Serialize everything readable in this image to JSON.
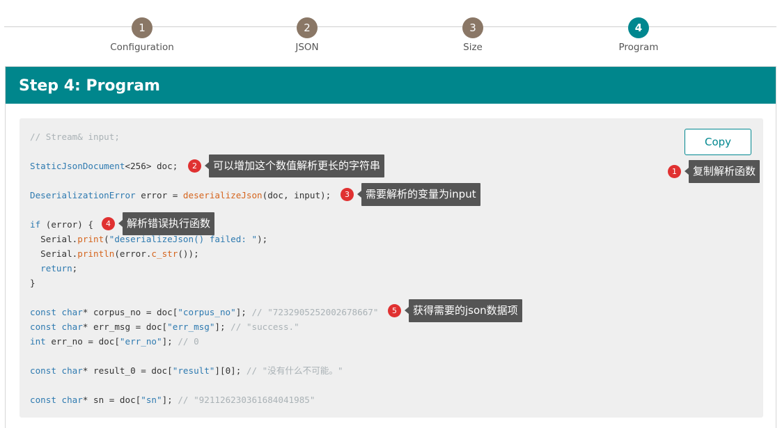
{
  "stepper": {
    "steps": [
      {
        "number": "1",
        "label": "Configuration"
      },
      {
        "number": "2",
        "label": "JSON"
      },
      {
        "number": "3",
        "label": "Size"
      },
      {
        "number": "4",
        "label": "Program"
      }
    ],
    "active_step": 4
  },
  "panel": {
    "title": "Step 4: Program",
    "copy_label": "Copy"
  },
  "code_lines": [
    [
      {
        "t": "// Stream& input;",
        "c": "comment"
      }
    ],
    [],
    [
      {
        "t": "StaticJsonDocument",
        "c": "type"
      },
      {
        "t": "<256> doc;",
        "c": "plain"
      }
    ],
    [],
    [
      {
        "t": "DeserializationError",
        "c": "type"
      },
      {
        "t": " error = ",
        "c": "plain"
      },
      {
        "t": "deserializeJson",
        "c": "fn"
      },
      {
        "t": "(doc, input);",
        "c": "plain"
      }
    ],
    [],
    [
      {
        "t": "if",
        "c": "kw"
      },
      {
        "t": " (error) {",
        "c": "plain"
      }
    ],
    [
      {
        "t": "  Serial.",
        "c": "plain"
      },
      {
        "t": "print",
        "c": "fn"
      },
      {
        "t": "(",
        "c": "plain"
      },
      {
        "t": "\"deserializeJson() failed: \"",
        "c": "str"
      },
      {
        "t": ");",
        "c": "plain"
      }
    ],
    [
      {
        "t": "  Serial.",
        "c": "plain"
      },
      {
        "t": "println",
        "c": "fn"
      },
      {
        "t": "(error.",
        "c": "plain"
      },
      {
        "t": "c_str",
        "c": "fn"
      },
      {
        "t": "());",
        "c": "plain"
      }
    ],
    [
      {
        "t": "  ",
        "c": "plain"
      },
      {
        "t": "return",
        "c": "kw"
      },
      {
        "t": ";",
        "c": "plain"
      }
    ],
    [
      {
        "t": "}",
        "c": "plain"
      }
    ],
    [],
    [
      {
        "t": "const char",
        "c": "kw"
      },
      {
        "t": "* corpus_no = doc[",
        "c": "plain"
      },
      {
        "t": "\"corpus_no\"",
        "c": "str"
      },
      {
        "t": "]; ",
        "c": "plain"
      },
      {
        "t": "// \"7232905252002678667\"",
        "c": "comment"
      }
    ],
    [
      {
        "t": "const char",
        "c": "kw"
      },
      {
        "t": "* err_msg = doc[",
        "c": "plain"
      },
      {
        "t": "\"err_msg\"",
        "c": "str"
      },
      {
        "t": "]; ",
        "c": "plain"
      },
      {
        "t": "// \"success.\"",
        "c": "comment"
      }
    ],
    [
      {
        "t": "int",
        "c": "kw"
      },
      {
        "t": " err_no = doc[",
        "c": "plain"
      },
      {
        "t": "\"err_no\"",
        "c": "str"
      },
      {
        "t": "]; ",
        "c": "plain"
      },
      {
        "t": "// 0",
        "c": "comment"
      }
    ],
    [],
    [
      {
        "t": "const char",
        "c": "kw"
      },
      {
        "t": "* result_0 = doc[",
        "c": "plain"
      },
      {
        "t": "\"result\"",
        "c": "str"
      },
      {
        "t": "][0]; ",
        "c": "plain"
      },
      {
        "t": "// \"没有什么不可能。\"",
        "c": "comment"
      }
    ],
    [],
    [
      {
        "t": "const char",
        "c": "kw"
      },
      {
        "t": "* sn = doc[",
        "c": "plain"
      },
      {
        "t": "\"sn\"",
        "c": "str"
      },
      {
        "t": "]; ",
        "c": "plain"
      },
      {
        "t": "// \"921126230361684041985\"",
        "c": "comment"
      }
    ]
  ],
  "annotations": [
    {
      "number": "1",
      "text": "复制解析函数"
    },
    {
      "number": "2",
      "text": "可以增加这个数值解析更长的字符串"
    },
    {
      "number": "3",
      "text": "需要解析的变量为input"
    },
    {
      "number": "4",
      "text": "解析错误执行函数"
    },
    {
      "number": "5",
      "text": "获得需要的json数据项"
    }
  ],
  "colors": {
    "accent": "#00868c",
    "step_inactive": "#8a7766",
    "badge": "#e03131",
    "tooltip": "#555555"
  }
}
